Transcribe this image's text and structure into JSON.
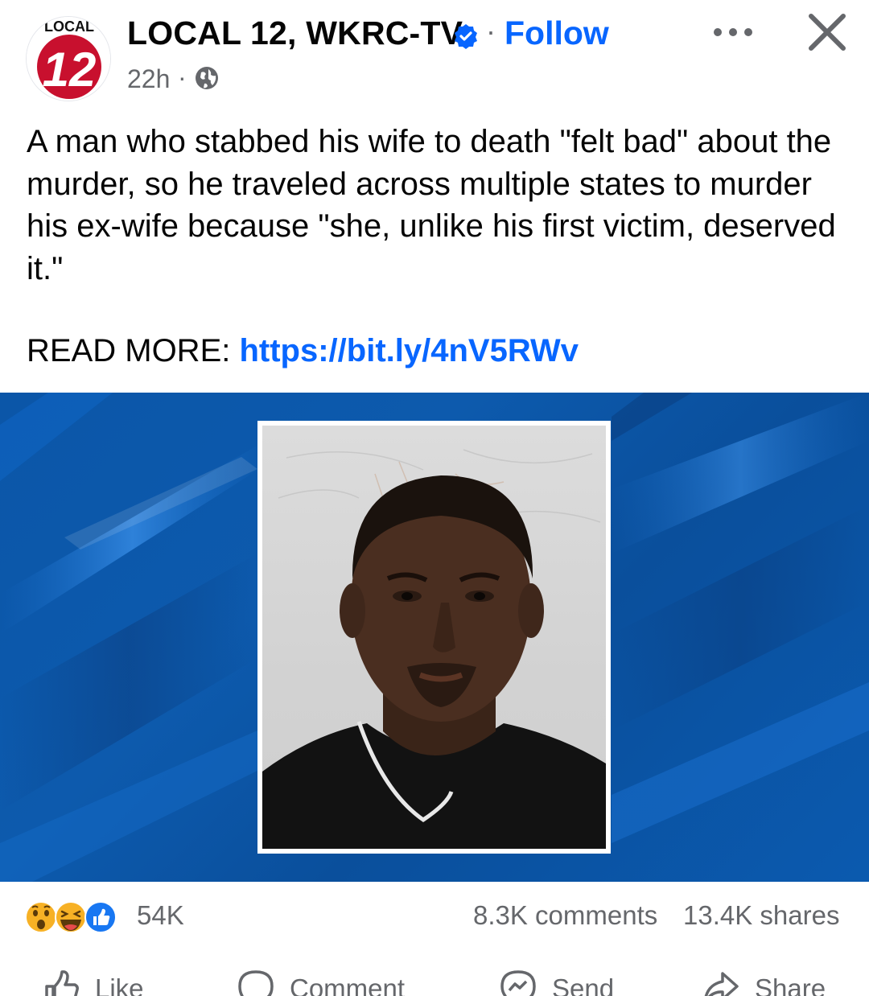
{
  "post": {
    "page_name": "LOCAL 12, WKRC-TV",
    "follow_label": "Follow",
    "time": "22h",
    "separator": "·",
    "avatar": {
      "top_text": "LOCAL",
      "number": "12",
      "color": "#c8102e"
    },
    "text": "A man who stabbed his wife to death \"felt bad\" about the murder, so he traveled across multiple states to murder his ex-wife because \"she, unlike his first victim, deserved it.\"",
    "read_more_label": "READ MORE: ",
    "link": "https://bit.ly/4nV5RWv"
  },
  "icons": {
    "verified": "verified-badge-icon",
    "globe": "globe-icon",
    "more": "more-options-icon",
    "close": "close-icon"
  },
  "stats": {
    "reaction_count": "54K",
    "comments": "8.3K comments",
    "shares": "13.4K shares",
    "reaction_icons": [
      "wow-icon",
      "haha-icon",
      "like-icon"
    ]
  },
  "actions": {
    "like": "Like",
    "comment": "Comment",
    "send": "Send",
    "share": "Share"
  },
  "colors": {
    "link_blue": "#0866ff",
    "secondary_text": "#65676b",
    "background_blue": "#0b56a8"
  }
}
